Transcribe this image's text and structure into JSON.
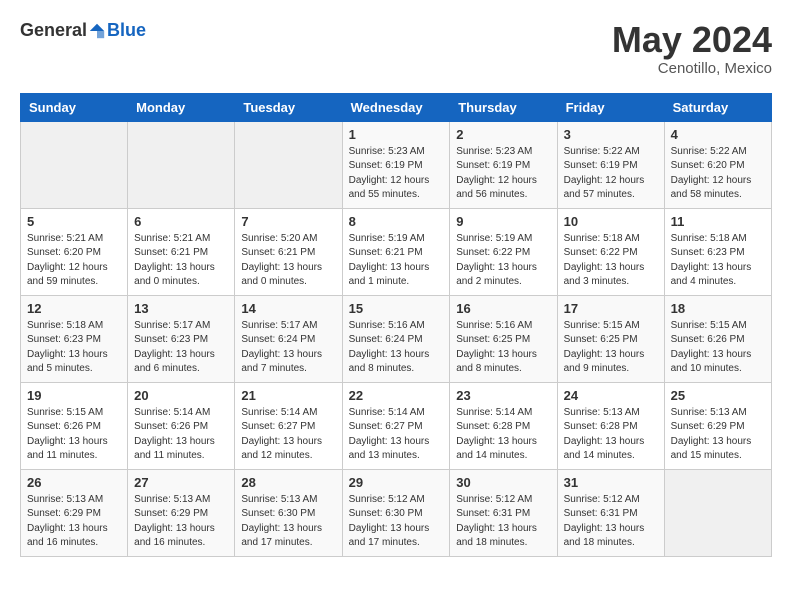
{
  "header": {
    "logo_general": "General",
    "logo_blue": "Blue",
    "month_year": "May 2024",
    "location": "Cenotillo, Mexico"
  },
  "days_of_week": [
    "Sunday",
    "Monday",
    "Tuesday",
    "Wednesday",
    "Thursday",
    "Friday",
    "Saturday"
  ],
  "weeks": [
    [
      {
        "day": "",
        "sunrise": "",
        "sunset": "",
        "daylight": ""
      },
      {
        "day": "",
        "sunrise": "",
        "sunset": "",
        "daylight": ""
      },
      {
        "day": "",
        "sunrise": "",
        "sunset": "",
        "daylight": ""
      },
      {
        "day": "1",
        "sunrise": "Sunrise: 5:23 AM",
        "sunset": "Sunset: 6:19 PM",
        "daylight": "Daylight: 12 hours and 55 minutes."
      },
      {
        "day": "2",
        "sunrise": "Sunrise: 5:23 AM",
        "sunset": "Sunset: 6:19 PM",
        "daylight": "Daylight: 12 hours and 56 minutes."
      },
      {
        "day": "3",
        "sunrise": "Sunrise: 5:22 AM",
        "sunset": "Sunset: 6:19 PM",
        "daylight": "Daylight: 12 hours and 57 minutes."
      },
      {
        "day": "4",
        "sunrise": "Sunrise: 5:22 AM",
        "sunset": "Sunset: 6:20 PM",
        "daylight": "Daylight: 12 hours and 58 minutes."
      }
    ],
    [
      {
        "day": "5",
        "sunrise": "Sunrise: 5:21 AM",
        "sunset": "Sunset: 6:20 PM",
        "daylight": "Daylight: 12 hours and 59 minutes."
      },
      {
        "day": "6",
        "sunrise": "Sunrise: 5:21 AM",
        "sunset": "Sunset: 6:21 PM",
        "daylight": "Daylight: 13 hours and 0 minutes."
      },
      {
        "day": "7",
        "sunrise": "Sunrise: 5:20 AM",
        "sunset": "Sunset: 6:21 PM",
        "daylight": "Daylight: 13 hours and 0 minutes."
      },
      {
        "day": "8",
        "sunrise": "Sunrise: 5:19 AM",
        "sunset": "Sunset: 6:21 PM",
        "daylight": "Daylight: 13 hours and 1 minute."
      },
      {
        "day": "9",
        "sunrise": "Sunrise: 5:19 AM",
        "sunset": "Sunset: 6:22 PM",
        "daylight": "Daylight: 13 hours and 2 minutes."
      },
      {
        "day": "10",
        "sunrise": "Sunrise: 5:18 AM",
        "sunset": "Sunset: 6:22 PM",
        "daylight": "Daylight: 13 hours and 3 minutes."
      },
      {
        "day": "11",
        "sunrise": "Sunrise: 5:18 AM",
        "sunset": "Sunset: 6:23 PM",
        "daylight": "Daylight: 13 hours and 4 minutes."
      }
    ],
    [
      {
        "day": "12",
        "sunrise": "Sunrise: 5:18 AM",
        "sunset": "Sunset: 6:23 PM",
        "daylight": "Daylight: 13 hours and 5 minutes."
      },
      {
        "day": "13",
        "sunrise": "Sunrise: 5:17 AM",
        "sunset": "Sunset: 6:23 PM",
        "daylight": "Daylight: 13 hours and 6 minutes."
      },
      {
        "day": "14",
        "sunrise": "Sunrise: 5:17 AM",
        "sunset": "Sunset: 6:24 PM",
        "daylight": "Daylight: 13 hours and 7 minutes."
      },
      {
        "day": "15",
        "sunrise": "Sunrise: 5:16 AM",
        "sunset": "Sunset: 6:24 PM",
        "daylight": "Daylight: 13 hours and 8 minutes."
      },
      {
        "day": "16",
        "sunrise": "Sunrise: 5:16 AM",
        "sunset": "Sunset: 6:25 PM",
        "daylight": "Daylight: 13 hours and 8 minutes."
      },
      {
        "day": "17",
        "sunrise": "Sunrise: 5:15 AM",
        "sunset": "Sunset: 6:25 PM",
        "daylight": "Daylight: 13 hours and 9 minutes."
      },
      {
        "day": "18",
        "sunrise": "Sunrise: 5:15 AM",
        "sunset": "Sunset: 6:26 PM",
        "daylight": "Daylight: 13 hours and 10 minutes."
      }
    ],
    [
      {
        "day": "19",
        "sunrise": "Sunrise: 5:15 AM",
        "sunset": "Sunset: 6:26 PM",
        "daylight": "Daylight: 13 hours and 11 minutes."
      },
      {
        "day": "20",
        "sunrise": "Sunrise: 5:14 AM",
        "sunset": "Sunset: 6:26 PM",
        "daylight": "Daylight: 13 hours and 11 minutes."
      },
      {
        "day": "21",
        "sunrise": "Sunrise: 5:14 AM",
        "sunset": "Sunset: 6:27 PM",
        "daylight": "Daylight: 13 hours and 12 minutes."
      },
      {
        "day": "22",
        "sunrise": "Sunrise: 5:14 AM",
        "sunset": "Sunset: 6:27 PM",
        "daylight": "Daylight: 13 hours and 13 minutes."
      },
      {
        "day": "23",
        "sunrise": "Sunrise: 5:14 AM",
        "sunset": "Sunset: 6:28 PM",
        "daylight": "Daylight: 13 hours and 14 minutes."
      },
      {
        "day": "24",
        "sunrise": "Sunrise: 5:13 AM",
        "sunset": "Sunset: 6:28 PM",
        "daylight": "Daylight: 13 hours and 14 minutes."
      },
      {
        "day": "25",
        "sunrise": "Sunrise: 5:13 AM",
        "sunset": "Sunset: 6:29 PM",
        "daylight": "Daylight: 13 hours and 15 minutes."
      }
    ],
    [
      {
        "day": "26",
        "sunrise": "Sunrise: 5:13 AM",
        "sunset": "Sunset: 6:29 PM",
        "daylight": "Daylight: 13 hours and 16 minutes."
      },
      {
        "day": "27",
        "sunrise": "Sunrise: 5:13 AM",
        "sunset": "Sunset: 6:29 PM",
        "daylight": "Daylight: 13 hours and 16 minutes."
      },
      {
        "day": "28",
        "sunrise": "Sunrise: 5:13 AM",
        "sunset": "Sunset: 6:30 PM",
        "daylight": "Daylight: 13 hours and 17 minutes."
      },
      {
        "day": "29",
        "sunrise": "Sunrise: 5:12 AM",
        "sunset": "Sunset: 6:30 PM",
        "daylight": "Daylight: 13 hours and 17 minutes."
      },
      {
        "day": "30",
        "sunrise": "Sunrise: 5:12 AM",
        "sunset": "Sunset: 6:31 PM",
        "daylight": "Daylight: 13 hours and 18 minutes."
      },
      {
        "day": "31",
        "sunrise": "Sunrise: 5:12 AM",
        "sunset": "Sunset: 6:31 PM",
        "daylight": "Daylight: 13 hours and 18 minutes."
      },
      {
        "day": "",
        "sunrise": "",
        "sunset": "",
        "daylight": ""
      }
    ]
  ]
}
